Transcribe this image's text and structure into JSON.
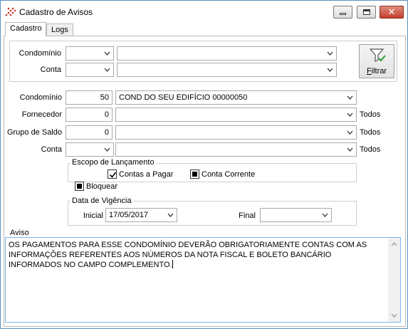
{
  "window": {
    "title": "Cadastro de Avisos",
    "close_symbol": "✕"
  },
  "tabs": [
    {
      "label": "Cadastro",
      "active": true
    },
    {
      "label": "Logs",
      "active": false
    }
  ],
  "filter": {
    "condominio_label": "Condomínio",
    "conta_label": "Conta",
    "filtrar_label": "Filtrar"
  },
  "form": {
    "condominio": {
      "label": "Condomínio",
      "code": "50",
      "name": "COND DO SEU EDIFÍCIO 00000050"
    },
    "fornecedor": {
      "label": "Fornecedor",
      "code": "0",
      "name": "",
      "suffix": "Todos"
    },
    "grupo_saldo": {
      "label": "Grupo de Saldo",
      "code": "0",
      "name": "",
      "suffix": "Todos"
    },
    "conta": {
      "label": "Conta",
      "code": "",
      "name": "",
      "suffix": "Todos"
    }
  },
  "escopo": {
    "title": "Escopo de Lançamento",
    "contas_a_pagar": {
      "label": "Contas a Pagar",
      "checked": true
    },
    "conta_corrente": {
      "label": "Conta Corrente",
      "checked": true
    },
    "bloquear": {
      "label": "Bloquear",
      "checked": true
    }
  },
  "vigencia": {
    "title": "Data de Vigência",
    "inicial_label": "Inicial",
    "inicial_value": "17/05/2017",
    "final_label": "Final",
    "final_value": ""
  },
  "aviso": {
    "title": "Aviso",
    "text": "OS PAGAMENTOS PARA ESSE CONDOMÍNIO DEVERÃO OBRIGATORIAMENTE CONTAS COM AS INFORMAÇÕES REFERENTES AOS NÚMEROS DA NOTA FISCAL E BOLETO BANCÁRIO INFORMADOS NO CAMPO COMPLEMENTO."
  },
  "colors": {
    "accent_border": "#7eb4ea",
    "close_button": "#c4412c"
  },
  "icons": {
    "app": "dots-grid-icon",
    "filter": "funnel-icon"
  }
}
